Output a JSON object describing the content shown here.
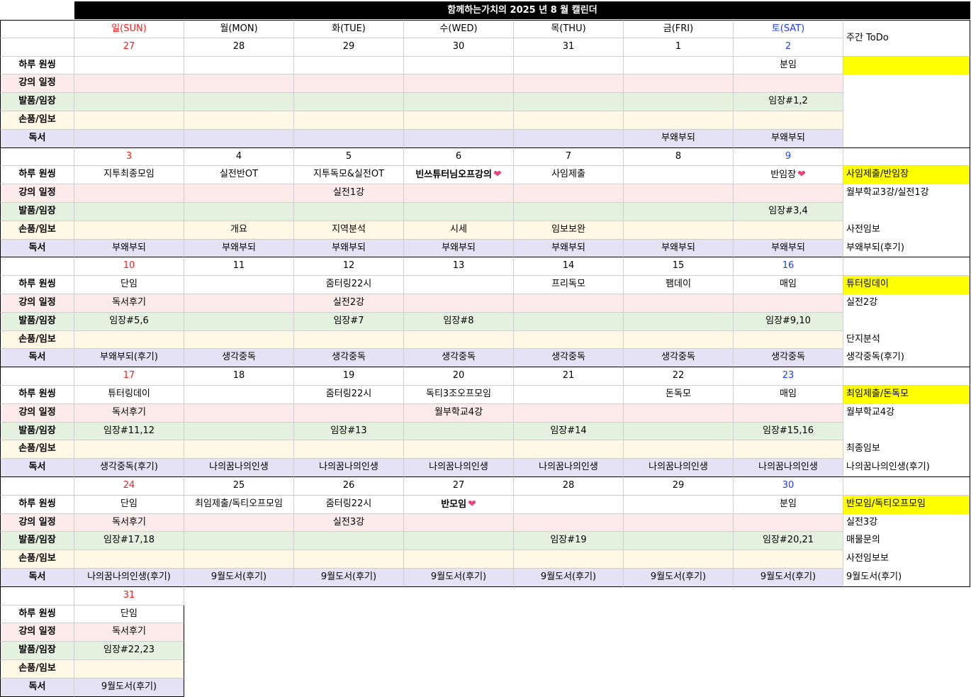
{
  "title": "함께하는가치의 2025 년 8 월 캘린더",
  "todo_header": "주간 ToDo",
  "days": [
    {
      "label": "일(SUN)",
      "color": "red"
    },
    {
      "label": "월(MON)",
      "color": "black"
    },
    {
      "label": "화(TUE)",
      "color": "black"
    },
    {
      "label": "수(WED)",
      "color": "black"
    },
    {
      "label": "목(THU)",
      "color": "black"
    },
    {
      "label": "금(FRI)",
      "color": "black"
    },
    {
      "label": "토(SAT)",
      "color": "blue"
    }
  ],
  "row_labels": [
    "하루 원씽",
    "강의 일정",
    "발품/임장",
    "손품/임보",
    "독서"
  ],
  "row_colors": [
    "#ffffff",
    "#fdeaea",
    "#e4f1df",
    "#fff8e4",
    "#e6e2f5"
  ],
  "heart_color": "#e8457a",
  "highlight_color": "#ffff00",
  "weeks": [
    {
      "dates": [
        "27",
        "28",
        "29",
        "30",
        "31",
        "1",
        "2"
      ],
      "cells": [
        [
          "",
          "",
          "",
          "",
          "",
          "",
          "분임"
        ],
        [
          "",
          "",
          "",
          "",
          "",
          "",
          ""
        ],
        [
          "",
          "",
          "",
          "",
          "",
          "",
          "임장#1,2"
        ],
        [
          "",
          "",
          "",
          "",
          "",
          "",
          ""
        ],
        [
          "",
          "",
          "",
          "",
          "",
          "부왜부되",
          "부왜부되"
        ]
      ],
      "todo": [
        "",
        "",
        "",
        "",
        ""
      ],
      "todo_top": ""
    },
    {
      "dates": [
        "3",
        "4",
        "5",
        "6",
        "7",
        "8",
        "9"
      ],
      "cells": [
        [
          "지투최종모임",
          "실전반OT",
          "지투독모&실전OT",
          "빈쓰튜터님오프강의",
          "사임제출",
          "",
          "반임장"
        ],
        [
          "",
          "",
          "실전1강",
          "",
          "",
          "",
          ""
        ],
        [
          "",
          "",
          "",
          "",
          "",
          "",
          "임장#3,4"
        ],
        [
          "",
          "개요",
          "지역분석",
          "시세",
          "임보보완",
          "",
          ""
        ],
        [
          "부왜부되",
          "부왜부되",
          "부왜부되",
          "부왜부되",
          "부왜부되",
          "부왜부되",
          "부왜부되"
        ]
      ],
      "todo": [
        "사임제출/반임장",
        "월부학교3강/실전1강",
        "",
        "사전임보",
        "부왜부되(후기)"
      ],
      "todo_top": ""
    },
    {
      "dates": [
        "10",
        "11",
        "12",
        "13",
        "14",
        "15",
        "16"
      ],
      "cells": [
        [
          "단임",
          "",
          "줌터링22시",
          "",
          "프리독모",
          "팸데이",
          "매임"
        ],
        [
          "독서후기",
          "",
          "실전2강",
          "",
          "",
          "",
          ""
        ],
        [
          "임장#5,6",
          "",
          "임장#7",
          "임장#8",
          "",
          "",
          "임장#9,10"
        ],
        [
          "",
          "",
          "",
          "",
          "",
          "",
          ""
        ],
        [
          "부왜부되(후기)",
          "생각중독",
          "생각중독",
          "생각중독",
          "생각중독",
          "생각중독",
          "생각중독"
        ]
      ],
      "todo": [
        "튜터링데이",
        "실전2강",
        "",
        "단지분석",
        "생각중독(후기)"
      ],
      "todo_top": ""
    },
    {
      "dates": [
        "17",
        "18",
        "19",
        "20",
        "21",
        "22",
        "23"
      ],
      "cells": [
        [
          "튜터링데이",
          "",
          "줌터링22시",
          "독티3조오프모임",
          "",
          "돈독모",
          "매임"
        ],
        [
          "독서후기",
          "",
          "",
          "월부학교4강",
          "",
          "",
          ""
        ],
        [
          "임장#11,12",
          "",
          "임장#13",
          "",
          "임장#14",
          "",
          "임장#15,16"
        ],
        [
          "",
          "",
          "",
          "",
          "",
          "",
          ""
        ],
        [
          "생각중독(후기)",
          "나의꿈나의인생",
          "나의꿈나의인생",
          "나의꿈나의인생",
          "나의꿈나의인생",
          "나의꿈나의인생",
          "나의꿈나의인생"
        ]
      ],
      "todo": [
        "최임제출/돈독모",
        "월부학교4강",
        "",
        "최종임보",
        "나의꿈나의인생(후기)"
      ],
      "todo_top": ""
    },
    {
      "dates": [
        "24",
        "25",
        "26",
        "27",
        "28",
        "29",
        "30"
      ],
      "cells": [
        [
          "단임",
          "최임제출/독티오프모임",
          "줌터링22시",
          "반모임",
          "",
          "",
          "분임"
        ],
        [
          "독서후기",
          "",
          "실전3강",
          "",
          "",
          "",
          ""
        ],
        [
          "임장#17,18",
          "",
          "",
          "",
          "임장#19",
          "",
          "임장#20,21"
        ],
        [
          "",
          "",
          "",
          "",
          "",
          "",
          ""
        ],
        [
          "나의꿈나의인생(후기)",
          "9월도서(후기)",
          "9월도서(후기)",
          "9월도서(후기)",
          "9월도서(후기)",
          "9월도서(후기)",
          "9월도서(후기)"
        ]
      ],
      "todo": [
        "반모임/독티오프모임",
        "실전3강",
        "매물문의",
        "사전임보보",
        "9월도서(후기)"
      ],
      "todo_top": ""
    },
    {
      "dates": [
        "31"
      ],
      "cells": [
        [
          "단임"
        ],
        [
          "독서후기"
        ],
        [
          "임장#22,23"
        ],
        [
          ""
        ],
        [
          "9월도서(후기)"
        ]
      ]
    }
  ],
  "bold_cells": [
    "1-0-3",
    "4-0-3"
  ],
  "heart_cells": [
    "1-0-3",
    "1-0-6",
    "4-0-3"
  ]
}
